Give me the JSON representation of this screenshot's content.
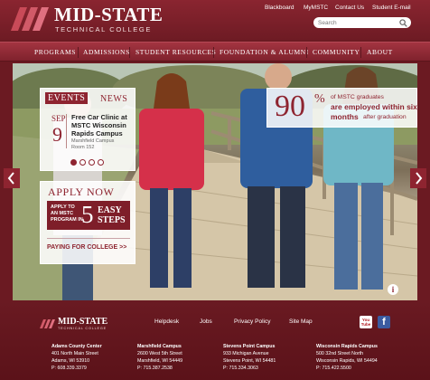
{
  "header": {
    "logo_name": "MID-STATE",
    "logo_sub": "TECHNICAL COLLEGE",
    "utility_links": [
      "Blackboard",
      "MyMSTC",
      "Contact Us",
      "Student E-mail"
    ],
    "search_placeholder": "Search"
  },
  "nav": {
    "items": [
      "PROGRAMS",
      "ADMISSIONS",
      "STUDENT RESOURCES",
      "FOUNDATION & ALUMNI",
      "COMMUNITY",
      "ABOUT"
    ]
  },
  "hero": {
    "events": {
      "tag_left": "EVENTS",
      "tag_right": "NEWS",
      "month": "SEP",
      "day": "9",
      "title": "Free Car Clinic at MSTC Wisconsin Rapids Campus",
      "location_line1": "Marshfield Campus",
      "location_line2": "Room 152",
      "pager_dots": 4,
      "active_dot": 1
    },
    "apply": {
      "title": "APPLY NOW",
      "small_text": "APPLY TO AN MSTC PROGRAM IN",
      "number": "5",
      "steps_text": "EASY STEPS",
      "link": "PAYING FOR COLLEGE >>"
    },
    "stat": {
      "number": "90",
      "percent": "%",
      "line1": "of MSTC graduates",
      "line2": "are employed within six",
      "line3_bold": "months",
      "line3_rest": "after graduation"
    },
    "info_glyph": "i"
  },
  "footer": {
    "logo_name": "MID-STATE",
    "logo_sub": "TECHNICAL COLLEGE",
    "links": [
      "Helpdesk",
      "Jobs",
      "Privacy Policy",
      "Site Map"
    ],
    "youtube_label": "You Tube",
    "facebook_glyph": "f",
    "campuses": [
      {
        "name": "Adams County Center",
        "address": "401 North Main Street",
        "city": "Adams, WI 53910",
        "phone": "P: 608.339.3379"
      },
      {
        "name": "Marshfield Campus",
        "address": "2600 West 5th Street",
        "city": "Marshfield, WI 54449",
        "phone": "P: 715.387.2538"
      },
      {
        "name": "Stevens Point Campus",
        "address": "933 Michigan Avenue",
        "city": "Stevens Point, WI 54481",
        "phone": "P: 715.334.3063"
      },
      {
        "name": "Wisconsin Rapids Campus",
        "address": "500 32nd Street North",
        "city": "Wisconsin Rapids, WI 54494",
        "phone": "P: 715.422.5500"
      }
    ]
  },
  "colors": {
    "brand": "#8e2430",
    "brand_dark": "#6b1a22",
    "nav": "#a33441"
  }
}
